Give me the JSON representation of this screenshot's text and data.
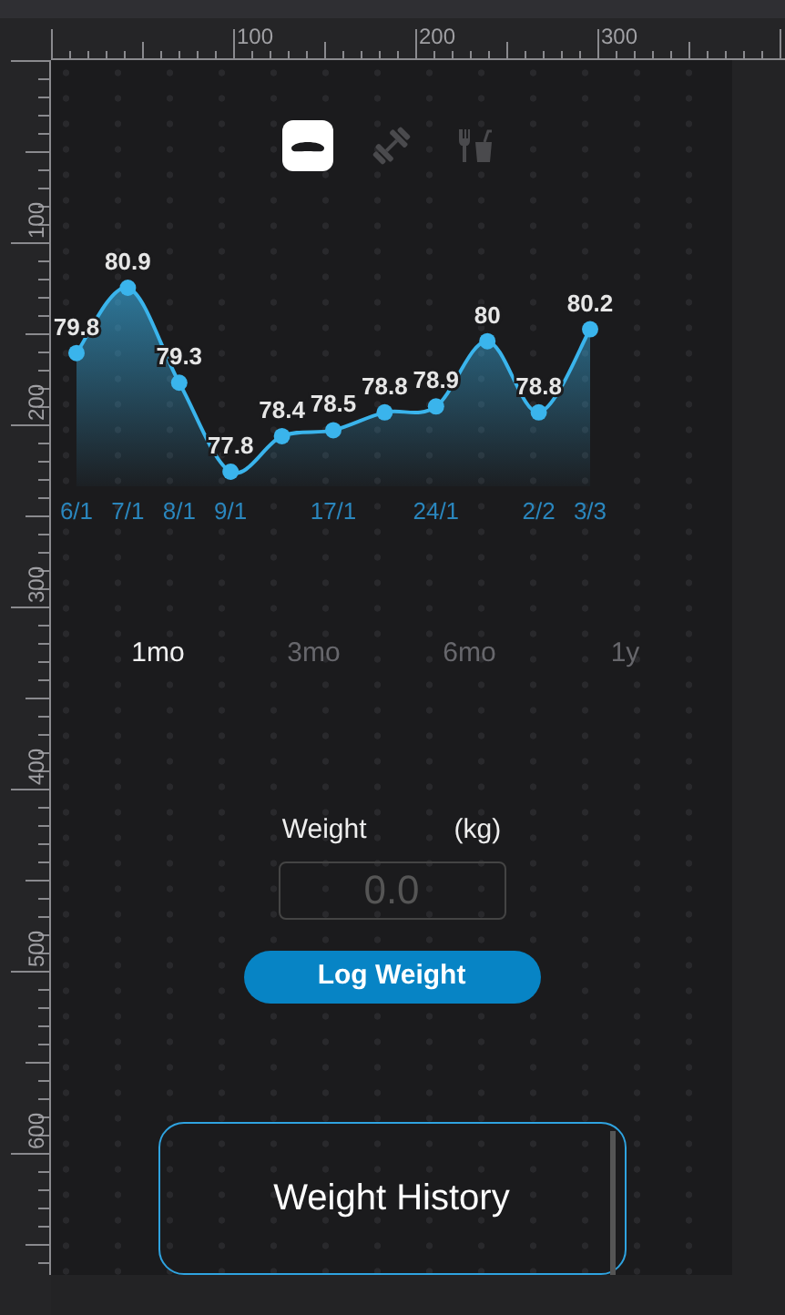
{
  "rulers": {
    "top_labels": [
      "100",
      "200",
      "300"
    ],
    "left_labels": [
      "100",
      "200",
      "300",
      "400",
      "500",
      "600"
    ]
  },
  "tabs": [
    {
      "selected": true
    },
    {
      "selected": false
    },
    {
      "selected": false
    }
  ],
  "chart": {
    "chart_data": {
      "type": "area",
      "categories": [
        "6/1",
        "7/1",
        "8/1",
        "9/1",
        null,
        "17/1",
        null,
        "24/1",
        null,
        "2/2",
        "3/3"
      ],
      "series": [
        {
          "color": "#3ab4ec",
          "values": [
            79.8,
            80.9,
            79.3,
            77.8,
            78.4,
            78.5,
            78.8,
            78.9,
            80,
            78.8,
            80.2
          ]
        }
      ],
      "data_labels": true
    }
  },
  "ranges": [
    {
      "label": "1mo",
      "selected": true
    },
    {
      "label": "3mo",
      "selected": false
    },
    {
      "label": "6mo",
      "selected": false
    },
    {
      "label": "1y",
      "selected": false
    }
  ],
  "form": {
    "label": "Weight",
    "unit": "(kg)",
    "placeholder": "0.0",
    "button": "Log Weight"
  },
  "history": {
    "title": "Weight History"
  }
}
